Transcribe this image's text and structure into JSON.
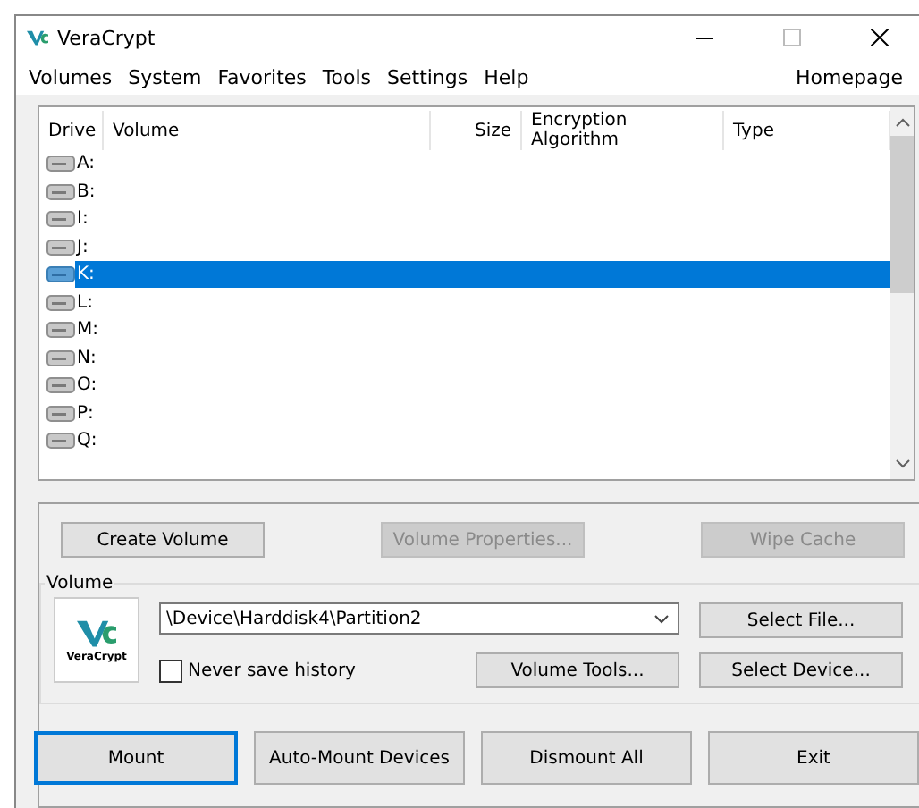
{
  "window": {
    "title": "VeraCrypt"
  },
  "menu": [
    "Volumes",
    "System",
    "Favorites",
    "Tools",
    "Settings",
    "Help"
  ],
  "homepage": "Homepage",
  "table": {
    "columns": [
      "Drive",
      "Volume",
      "Size",
      "Encryption Algorithm",
      "Type"
    ],
    "rows": [
      {
        "drive": "A:",
        "selected": false
      },
      {
        "drive": "B:",
        "selected": false
      },
      {
        "drive": "I:",
        "selected": false
      },
      {
        "drive": "J:",
        "selected": false
      },
      {
        "drive": "K:",
        "selected": true
      },
      {
        "drive": "L:",
        "selected": false
      },
      {
        "drive": "M:",
        "selected": false
      },
      {
        "drive": "N:",
        "selected": false
      },
      {
        "drive": "O:",
        "selected": false
      },
      {
        "drive": "P:",
        "selected": false
      },
      {
        "drive": "Q:",
        "selected": false
      }
    ]
  },
  "top_buttons": [
    {
      "label": "Create Volume",
      "disabled": false
    },
    {
      "label": "Volume Properties...",
      "disabled": true
    },
    {
      "label": "Wipe Cache",
      "disabled": true
    }
  ],
  "volume": {
    "group_label": "Volume",
    "logo_text": "VeraCrypt",
    "path": "\\Device\\Harddisk4\\Partition2",
    "never_save_history": {
      "label": "Never save history",
      "checked": false
    },
    "volume_tools": "Volume Tools...",
    "select_file": "Select File...",
    "select_device": "Select Device..."
  },
  "bottom_buttons": [
    {
      "label": "Mount",
      "focused": true
    },
    {
      "label": "Auto-Mount Devices",
      "focused": false
    },
    {
      "label": "Dismount All",
      "focused": false
    },
    {
      "label": "Exit",
      "focused": false
    }
  ]
}
